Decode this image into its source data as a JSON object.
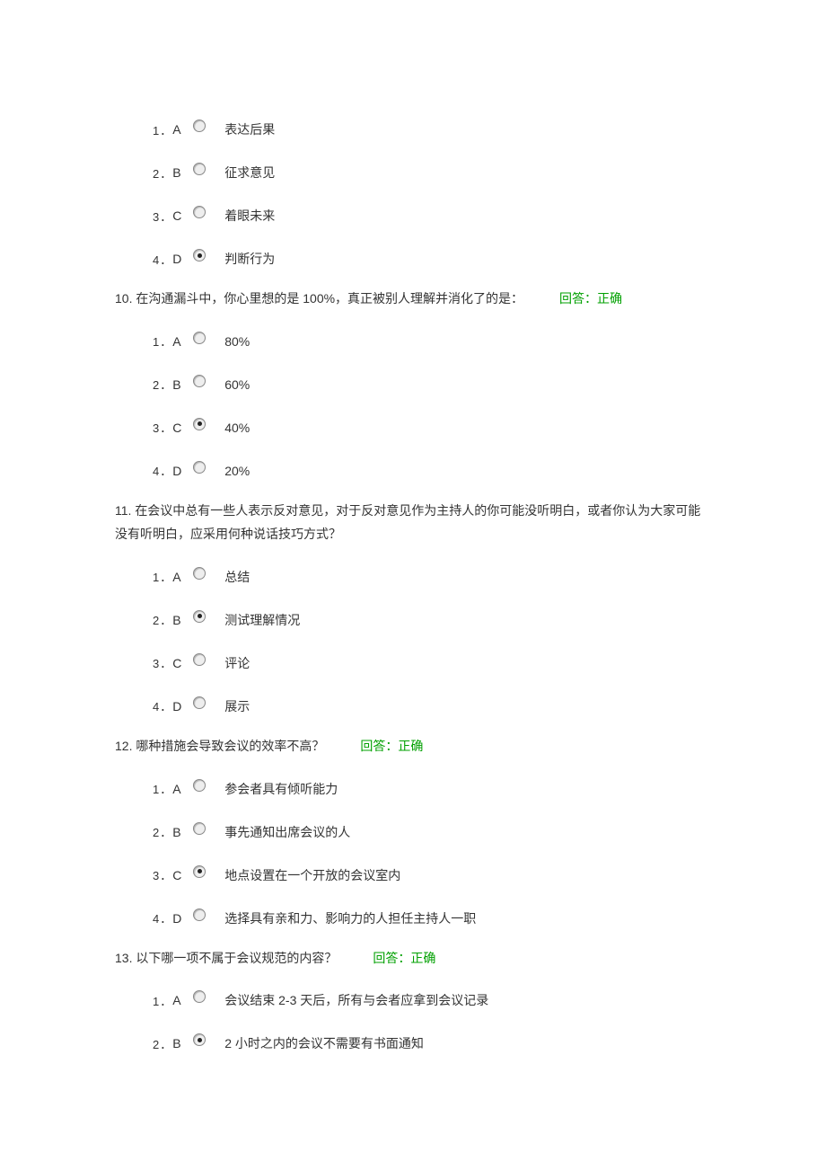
{
  "questions": [
    {
      "options": [
        {
          "num": "1．",
          "letter": "A",
          "selected": false,
          "text": "表达后果"
        },
        {
          "num": "2．",
          "letter": "B",
          "selected": false,
          "text": "征求意见"
        },
        {
          "num": "3．",
          "letter": "C",
          "selected": false,
          "text": "着眼未来"
        },
        {
          "num": "4．",
          "letter": "D",
          "selected": true,
          "text": "判断行为"
        }
      ],
      "prompt_parts": [
        "10. 在沟通漏斗中，你心里想的是 100%，真正被别人理解并消化了的是："
      ],
      "feedback": "回答：正确"
    },
    {
      "options": [
        {
          "num": "1．",
          "letter": "A",
          "selected": false,
          "text": "80%"
        },
        {
          "num": "2．",
          "letter": "B",
          "selected": false,
          "text": "60%"
        },
        {
          "num": "3．",
          "letter": "C",
          "selected": true,
          "text": "40%"
        },
        {
          "num": "4．",
          "letter": "D",
          "selected": false,
          "text": "20%"
        }
      ],
      "prompt_parts": [
        "11. 在会议中总有一些人表示反对意见，对于反对意见作为主持人的你可能没听明白，或者你认为大家可能没有听明白，应采用何种说话技巧方式？"
      ],
      "feedback": ""
    },
    {
      "options": [
        {
          "num": "1．",
          "letter": "A",
          "selected": false,
          "text": "总结"
        },
        {
          "num": "2．",
          "letter": "B",
          "selected": true,
          "text": "测试理解情况"
        },
        {
          "num": "3．",
          "letter": "C",
          "selected": false,
          "text": "评论"
        },
        {
          "num": "4．",
          "letter": "D",
          "selected": false,
          "text": "展示"
        }
      ],
      "prompt_parts": [
        "12. 哪种措施会导致会议的效率不高？"
      ],
      "feedback": "回答：正确"
    },
    {
      "options": [
        {
          "num": "1．",
          "letter": "A",
          "selected": false,
          "text": "参会者具有倾听能力"
        },
        {
          "num": "2．",
          "letter": "B",
          "selected": false,
          "text": "事先通知出席会议的人"
        },
        {
          "num": "3．",
          "letter": "C",
          "selected": true,
          "text": "地点设置在一个开放的会议室内"
        },
        {
          "num": "4．",
          "letter": "D",
          "selected": false,
          "text": "选择具有亲和力、影响力的人担任主持人一职"
        }
      ],
      "prompt_parts": [
        "13. 以下哪一项不属于会议规范的内容？"
      ],
      "feedback": "回答：正确"
    },
    {
      "options": [
        {
          "num": "1．",
          "letter": "A",
          "selected": false,
          "text": "会议结束 2-3 天后，所有与会者应拿到会议记录"
        },
        {
          "num": "2．",
          "letter": "B",
          "selected": true,
          "text": "2 小时之内的会议不需要有书面通知"
        }
      ],
      "prompt_parts": [],
      "feedback": ""
    }
  ]
}
